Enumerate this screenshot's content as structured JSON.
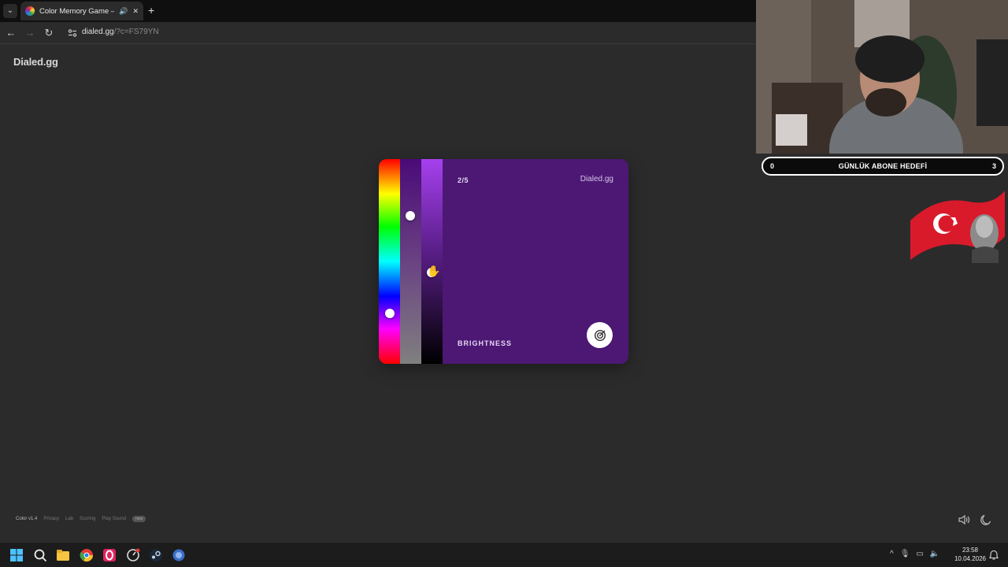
{
  "browser": {
    "tab_title": "Color Memory Game — Ho",
    "new_tab": "+",
    "address_host": "dialed.gg",
    "address_query": "/?c=FS79YN"
  },
  "page": {
    "logo": "Dialed.gg"
  },
  "game": {
    "round": "2/5",
    "card_logo": "Dialed.gg",
    "slider_label": "BRIGHTNESS",
    "background_color": "#4c1874"
  },
  "footer": {
    "version": "Color v1.4",
    "links": [
      "Privacy",
      "Lab",
      "Scoring",
      "Play Sound"
    ],
    "pill": "new"
  },
  "stream": {
    "goal_current": "0",
    "goal_label": "GÜNLÜK ABONE HEDEFİ",
    "goal_target": "3"
  },
  "taskbar": {
    "time": "23:58",
    "date": "10.04.2026"
  }
}
